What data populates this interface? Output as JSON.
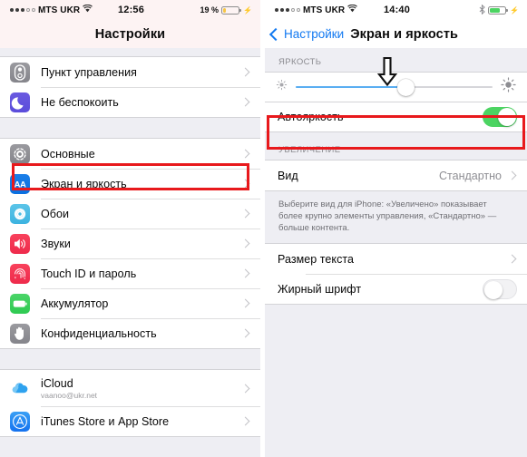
{
  "left": {
    "statusbar": {
      "carrier": "MTS UKR",
      "time": "12:56",
      "battery_text": "19 %",
      "battery_pct": 19,
      "battery_color": "#f6c544",
      "wifi_icon": "wifi-icon",
      "charging_icon": "bolt-icon"
    },
    "nav": {
      "title": "Настройки"
    },
    "groups": [
      {
        "rows": [
          {
            "label": "Пункт управления",
            "icon": "control-center-icon",
            "accessory": "chevron"
          },
          {
            "label": "Не беспокоить",
            "icon": "moon-icon",
            "accessory": "chevron"
          }
        ]
      },
      {
        "rows": [
          {
            "label": "Основные",
            "icon": "gear-icon",
            "accessory": "chevron"
          },
          {
            "label": "Экран и яркость",
            "icon": "display-aa-icon",
            "accessory": "chevron",
            "highlighted": true
          },
          {
            "label": "Обои",
            "icon": "wallpaper-flower-icon",
            "accessory": "chevron"
          },
          {
            "label": "Звуки",
            "icon": "speaker-icon",
            "accessory": "chevron"
          },
          {
            "label": "Touch ID и пароль",
            "icon": "fingerprint-icon",
            "accessory": "chevron"
          },
          {
            "label": "Аккумулятор",
            "icon": "battery-icon",
            "accessory": "chevron"
          },
          {
            "label": "Конфиденциальность",
            "icon": "hand-icon",
            "accessory": "chevron"
          }
        ]
      },
      {
        "rows": [
          {
            "label": "iCloud",
            "sublabel": "vaanoo@ukr.net",
            "icon": "icloud-icon",
            "accessory": "chevron"
          },
          {
            "label": "iTunes Store и App Store",
            "icon": "app-store-icon",
            "accessory": "chevron"
          }
        ]
      }
    ]
  },
  "right": {
    "statusbar": {
      "carrier": "MTS UKR",
      "time": "14:40",
      "battery_pct": 62,
      "battery_color": "#4cd462",
      "wifi_icon": "wifi-icon",
      "bluetooth_icon": "bluetooth-icon",
      "charging_icon": "bolt-icon"
    },
    "nav": {
      "back_label": "Настройки",
      "title": "Экран и яркость"
    },
    "brightness": {
      "section_header": "ЯРКОСТЬ",
      "slider_value": 56,
      "min_icon": "sun-small-icon",
      "max_icon": "sun-large-icon",
      "auto_label": "Автояркость",
      "auto_state": "on"
    },
    "zoom_section": {
      "section_header": "УВЕЛИЧЕНИЕ",
      "view_label": "Вид",
      "view_value": "Стандартно",
      "footnote": "Выберите вид для iPhone: «Увеличено» показывает более крупно элементы управления, «Стандартно» — больше контента."
    },
    "text_section": {
      "text_size_label": "Размер текста",
      "bold_label": "Жирный шрифт",
      "bold_state": "off"
    }
  },
  "annotations": {
    "highlight_color": "#e8191c",
    "arrow": "down-arrow-pointer"
  }
}
